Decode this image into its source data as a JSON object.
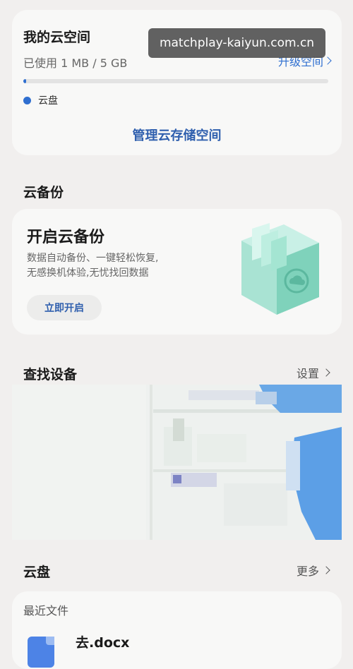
{
  "storage": {
    "title": "我的云空间",
    "usage": "已使用 1 MB / 5 GB",
    "upgrade_label": "升级空间",
    "used_fraction": 0.0002,
    "legend_label": "云盘",
    "legend_color": "#2f6fd0",
    "manage_label": "管理云存储空间"
  },
  "watermark": "matchplay-kaiyun.com.cn",
  "backup": {
    "section_title": "云备份",
    "heading": "开启云备份",
    "desc_line1": "数据自动备份、一键轻松恢复,",
    "desc_line2": "无感换机体验,无忧找回数据",
    "button_label": "立即开启",
    "illustration_icon": "cloud-box-icon"
  },
  "find_device": {
    "section_title": "查找设备",
    "settings_label": "设置"
  },
  "cloud_drive": {
    "section_title": "云盘",
    "more_label": "更多",
    "recent_label": "最近文件",
    "files": [
      {
        "name": "去.docx",
        "icon": "docx-file-icon"
      }
    ]
  },
  "colors": {
    "accent": "#2f6fd0",
    "link_dark": "#2f5fae",
    "background": "#f1efee",
    "card": "#f8f8f7"
  }
}
